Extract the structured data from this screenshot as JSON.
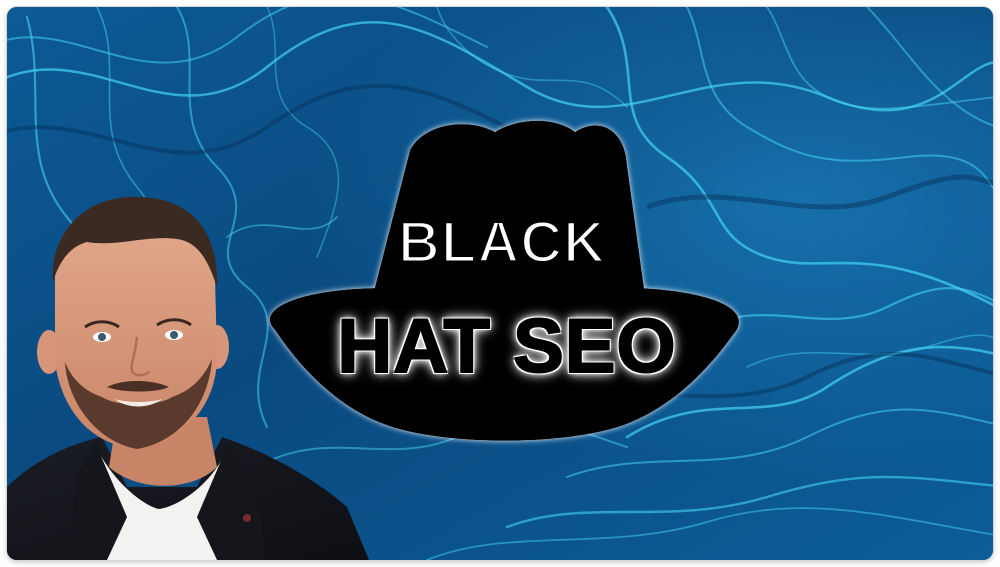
{
  "thumbnail": {
    "title_line1": "BLACK",
    "title_line2": "HAT SEO",
    "colors": {
      "background_primary": "#0b4f86",
      "background_highlight": "#3fd3f0",
      "hat": "#000000",
      "title_line1_fill": "#ffffff",
      "title_line2_fill": "#000000"
    },
    "icons": {
      "hat": "black-fedora-hat-icon",
      "person": "presenter-portrait"
    }
  }
}
